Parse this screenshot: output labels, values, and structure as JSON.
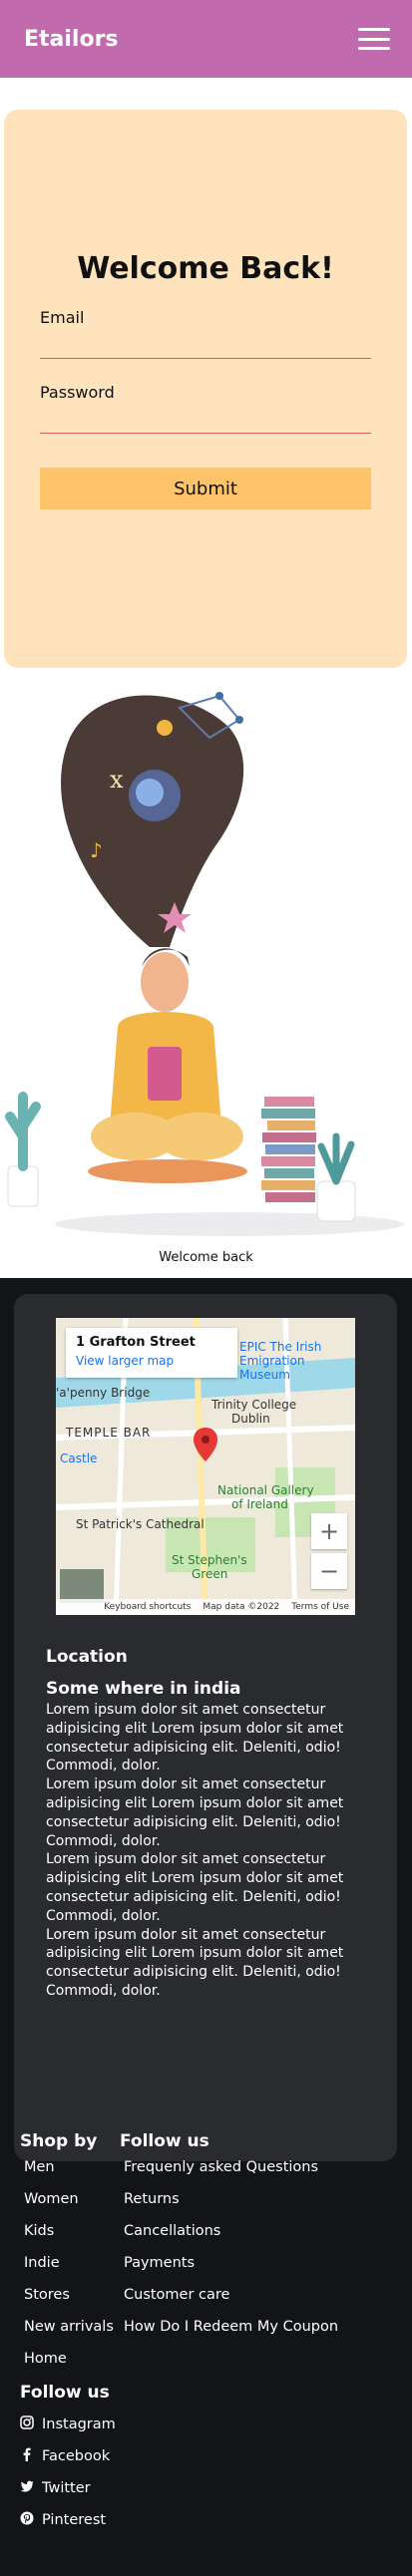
{
  "header": {
    "brand": "Etailors",
    "menu_icon": "hamburger-menu-icon"
  },
  "login": {
    "title": "Welcome Back!",
    "email_label": "Email",
    "email_value": "",
    "password_label": "Password",
    "password_value": "",
    "submit_label": "Submit"
  },
  "hero": {
    "caption": "Welcome back"
  },
  "map": {
    "address": "1 Grafton Street",
    "larger_map_link": "View larger map",
    "labels": [
      "EPIC The Irish",
      "Emigration Museum",
      "Trinity College",
      "Dublin",
      "TEMPLE BAR",
      "Castle",
      "National Gallery",
      "of Ireland",
      "St Patrick's Cathedral",
      "St Stephen's",
      "Green",
      "'a'penny Bridge"
    ],
    "zoom_in": "+",
    "zoom_out": "−",
    "footer": [
      "Keyboard shortcuts",
      "Map data ©2022",
      "Terms of Use"
    ],
    "colors": {
      "pin": "#e53935",
      "water": "#9fd8e8",
      "park": "#c8e6b4"
    }
  },
  "location": {
    "title": "Location",
    "subtitle": "Some where in india",
    "paragraphs": [
      "Lorem ipsum dolor sit amet consectetur adipisicing elit Lorem ipsum dolor sit amet consectetur adipisicing elit. Deleniti, odio! Commodi, dolor.",
      "Lorem ipsum dolor sit amet consectetur adipisicing elit Lorem ipsum dolor sit amet consectetur adipisicing elit. Deleniti, odio! Commodi, dolor.",
      "Lorem ipsum dolor sit amet consectetur adipisicing elit Lorem ipsum dolor sit amet consectetur adipisicing elit. Deleniti, odio! Commodi, dolor.",
      "Lorem ipsum dolor sit amet consectetur adipisicing elit Lorem ipsum dolor sit amet consectetur adipisicing elit. Deleniti, odio! Commodi, dolor."
    ]
  },
  "footer": {
    "shop_title": "Shop by",
    "shop_links": [
      "Men",
      "Women",
      "Kids",
      "Indie",
      "Stores",
      "New arrivals",
      "Home"
    ],
    "follow_title": "Follow us",
    "follow_links": [
      "Frequenly asked Questions",
      "Returns",
      "Cancellations",
      "Payments",
      "Customer care",
      "How Do I Redeem My Coupon"
    ],
    "social_title": "Follow us",
    "social": [
      {
        "label": "Instagram",
        "icon": "instagram-icon"
      },
      {
        "label": "Facebook",
        "icon": "facebook-icon"
      },
      {
        "label": "Twitter",
        "icon": "twitter-icon"
      },
      {
        "label": "Pinterest",
        "icon": "pinterest-icon"
      }
    ]
  }
}
